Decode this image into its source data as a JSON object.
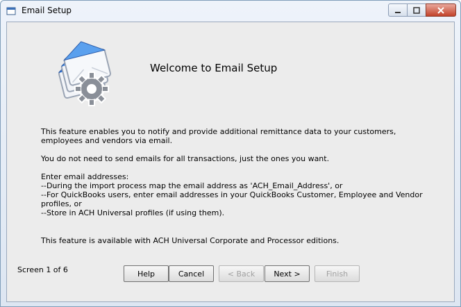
{
  "window": {
    "title": "Email Setup",
    "icon": "app-window-icon"
  },
  "main": {
    "heading": "Welcome to Email Setup",
    "hero_icon": "email-gear-icon",
    "paragraph_1": "This feature enables you to notify and provide additional remittance data to your customers, employees and vendors via email.",
    "paragraph_2": "You do not need to send emails for all transactions, just the ones you want.",
    "paragraph_3": "Enter email addresses:\n--During the import process map the email address as 'ACH_Email_Address', or\n--For QuickBooks users, enter email addresses in your QuickBooks Customer, Employee and Vendor profiles, or\n--Store in ACH Universal profiles (if using them).",
    "paragraph_4": "This feature is available with ACH Universal Corporate and Processor editions."
  },
  "footer": {
    "screen_label": "Screen 1 of 6",
    "buttons": {
      "help": "Help",
      "cancel": "Cancel",
      "back": "< Back",
      "next": "Next >",
      "finish": "Finish"
    }
  },
  "colors": {
    "envelope_blue": "#3d7ed6",
    "gear_gray": "#8a8f98",
    "close_red": "#c2422a"
  }
}
